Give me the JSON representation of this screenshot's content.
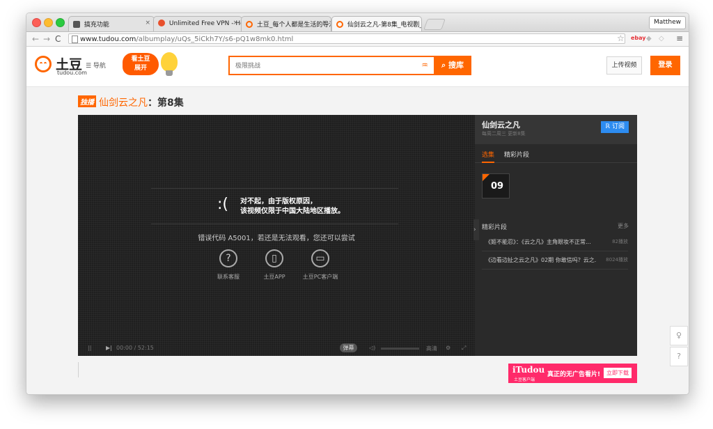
{
  "browser": {
    "tabs": [
      {
        "label": "搞充功能",
        "icon_color": "#555555",
        "active": false
      },
      {
        "label": "Unlimited Free VPN - Hola",
        "icon_color": "#e8502c",
        "active": false
      },
      {
        "label": "土豆_每个人都是生活的导演",
        "icon_color": "#ff6600",
        "active": false
      },
      {
        "label": "仙剑云之凡-第8集_电视剧_土豆",
        "icon_color": "#ff6600",
        "active": true
      }
    ],
    "user_button": "Matthew",
    "url_host": "www.tudou.com",
    "url_path": "/albumplay/uQs_5iCkh7Y/s6-pQ1w8mk0.html",
    "ext_label": "ebay"
  },
  "header": {
    "logo_text": "土豆",
    "logo_sub": "tudou.com",
    "nav_label": "☰ 导航",
    "promo_line1": "看土豆",
    "promo_line2": "展开",
    "search_placeholder": "极限挑战",
    "search_button": "搜库",
    "upload_button": "上传视频",
    "login_button": "登录"
  },
  "page": {
    "badge": "独播",
    "show_name": "仙剑云之凡",
    "episode": "：第8集"
  },
  "player": {
    "sad_face": ":(",
    "message_line1": "对不起，由于版权原因，",
    "message_line2": "该视频仅限于中国大陆地区播放。",
    "error_code": "错误代码 A5001，若还是无法观看，您还可以尝试",
    "options": [
      {
        "label": "联系客服",
        "icon": "?"
      },
      {
        "label": "土豆APP",
        "icon": "▯"
      },
      {
        "label": "土豆PC客户端",
        "icon": "▭"
      }
    ],
    "time": "00:00 / 52:15",
    "danmu_label": "弹幕",
    "quality_label": "高清"
  },
  "sidebar": {
    "title": "仙剑云之凡",
    "subtitle": "每周二周三 更新8集",
    "subscribe": "订阅",
    "tabs": [
      "选集",
      "精彩片段"
    ],
    "current_episode": "09",
    "section_title": "精彩片段",
    "more": "更多",
    "clips": [
      {
        "title": "《姬不能忍》：《云之凡》主角眼妆不正常...",
        "count": "82播放"
      },
      {
        "title": "《边看边扯之云之凡》02期 你敢信吗？云之...",
        "count": "8024播放"
      }
    ]
  },
  "ad": {
    "brand": "iTudou",
    "brand_sub": "土豆客户端",
    "text": "真正的无广告看片!",
    "button": "立即下载"
  },
  "side_icons": [
    "lightbulb-icon",
    "help-icon"
  ]
}
